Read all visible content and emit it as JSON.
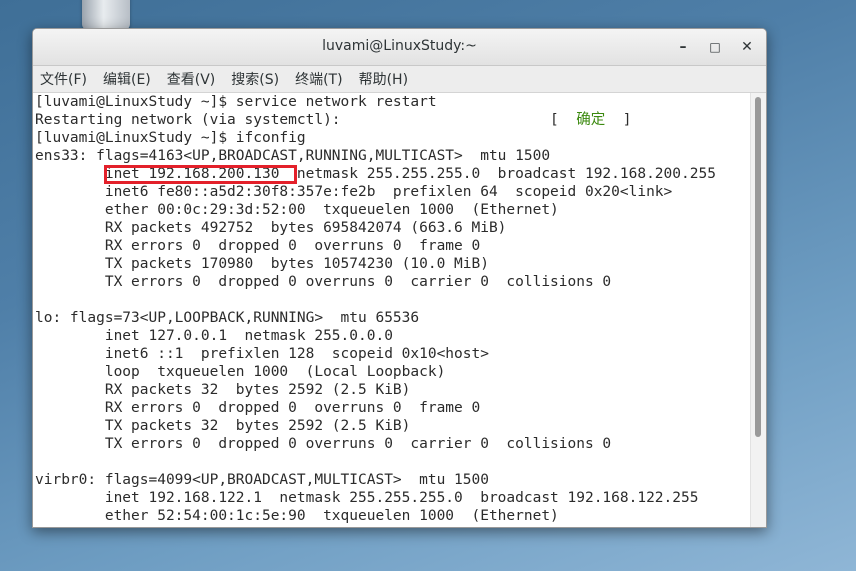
{
  "window": {
    "title": "luvami@LinuxStudy:~",
    "controls": {
      "minimize": "–",
      "maximize": "□",
      "close": "✕"
    }
  },
  "menu": [
    "文件(F)",
    "编辑(E)",
    "查看(V)",
    "搜索(S)",
    "终端(T)",
    "帮助(H)"
  ],
  "terminal": {
    "lines": [
      "[luvami@LinuxStudy ~]$ service network restart",
      "Restarting network (via systemctl):                        [  ",
      "[luvami@LinuxStudy ~]$ ifconfig",
      "ens33: flags=4163<UP,BROADCAST,RUNNING,MULTICAST>  mtu 1500",
      "        inet 192.168.200.130  netmask 255.255.255.0  broadcast 192.168.200.255",
      "        inet6 fe80::a5d2:30f8:357e:fe2b  prefixlen 64  scopeid 0x20<link>",
      "        ether 00:0c:29:3d:52:00  txqueuelen 1000  (Ethernet)",
      "        RX packets 492752  bytes 695842074 (663.6 MiB)",
      "        RX errors 0  dropped 0  overruns 0  frame 0",
      "        TX packets 170980  bytes 10574230 (10.0 MiB)",
      "        TX errors 0  dropped 0 overruns 0  carrier 0  collisions 0",
      "",
      "lo: flags=73<UP,LOOPBACK,RUNNING>  mtu 65536",
      "        inet 127.0.0.1  netmask 255.0.0.0",
      "        inet6 ::1  prefixlen 128  scopeid 0x10<host>",
      "        loop  txqueuelen 1000  (Local Loopback)",
      "        RX packets 32  bytes 2592 (2.5 KiB)",
      "        RX errors 0  dropped 0  overruns 0  frame 0",
      "        TX packets 32  bytes 2592 (2.5 KiB)",
      "        TX errors 0  dropped 0 overruns 0  carrier 0  collisions 0",
      "",
      "virbr0: flags=4099<UP,BROADCAST,MULTICAST>  mtu 1500",
      "        inet 192.168.122.1  netmask 255.255.255.0  broadcast 192.168.122.255",
      "        ether 52:54:00:1c:5e:90  txqueuelen 1000  (Ethernet)"
    ],
    "ok_text": "确定",
    "ok_close": "  ]"
  },
  "colors": {
    "highlight": "#e3202a",
    "ok": "#3c8a10"
  }
}
